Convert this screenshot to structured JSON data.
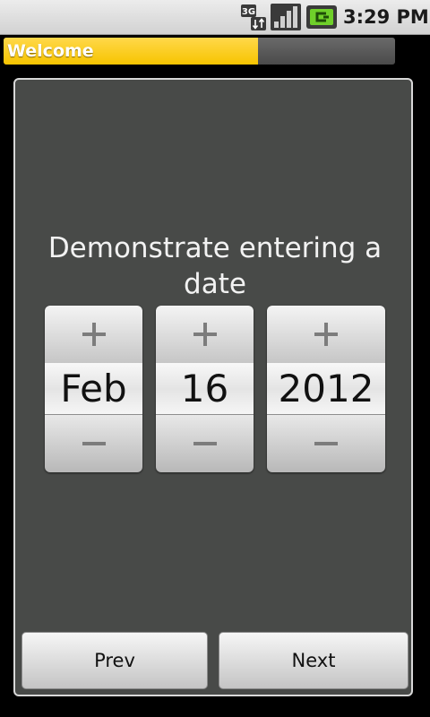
{
  "status_bar": {
    "network_label": "3G",
    "time": "3:29 PM",
    "icons": [
      "network-3g-icon",
      "signal-strength-icon",
      "battery-charging-icon"
    ]
  },
  "title_bar": {
    "title": "Welcome",
    "progress_fraction": 0.65,
    "accent_color": "#f7c400"
  },
  "prompt": "Demonstrate entering a date",
  "date_picker": {
    "month": "Feb",
    "day": "16",
    "year": "2012",
    "increment_symbol": "+",
    "decrement_symbol": "−"
  },
  "nav": {
    "prev_label": "Prev",
    "next_label": "Next"
  }
}
